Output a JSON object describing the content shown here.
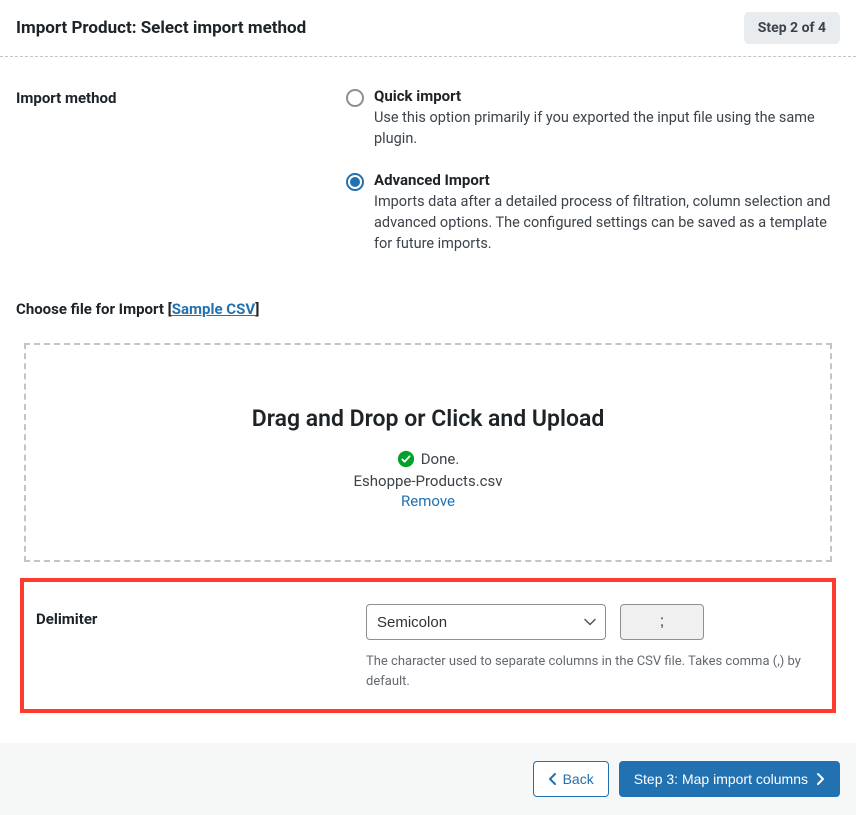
{
  "header": {
    "title": "Import Product: Select import method",
    "step_badge": "Step 2 of 4"
  },
  "import_method": {
    "label": "Import method",
    "options": [
      {
        "title": "Quick import",
        "desc": "Use this option primarily if you exported the input file using the same plugin.",
        "selected": false
      },
      {
        "title": "Advanced Import",
        "desc": "Imports data after a detailed process of filtration, column selection and advanced options. The configured settings can be saved as a template for future imports.",
        "selected": true
      }
    ]
  },
  "file": {
    "label_prefix": "Choose file for Import [",
    "sample_link": "Sample CSV",
    "label_suffix": "]",
    "drop_title": "Drag and Drop or Click and Upload",
    "done_text": "Done.",
    "filename": "Eshoppe-Products.csv",
    "remove_text": "Remove"
  },
  "delimiter": {
    "label": "Delimiter",
    "selected_option": "Semicolon",
    "value": ";",
    "help": "The character used to separate columns in the CSV file. Takes comma (,) by default."
  },
  "footer": {
    "back": "Back",
    "next": "Step 3: Map import columns"
  }
}
